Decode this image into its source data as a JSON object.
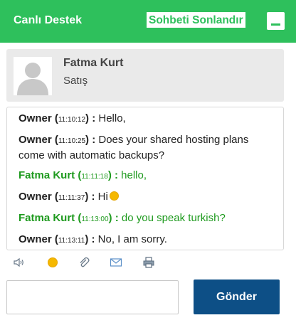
{
  "header": {
    "title": "Canlı Destek",
    "end_chat_label": "Sohbeti Sonlandır",
    "minimize_icon": "minimize-icon",
    "bg_color": "#2ec05c"
  },
  "agent": {
    "name": "Fatma Kurt",
    "department": "Satış",
    "avatar_icon": "user-avatar-icon"
  },
  "messages": [
    {
      "sender": "Owner",
      "time": "11:10:12",
      "text": "Hello,",
      "role": "visitor"
    },
    {
      "sender": "Owner",
      "time": "11:10:25",
      "text": "Does your shared hosting plans come with automatic backups?",
      "role": "visitor"
    },
    {
      "sender": "Fatma Kurt",
      "time": "11:11:18",
      "text": "hello,",
      "role": "agent"
    },
    {
      "sender": "Owner",
      "time": "11:11:37",
      "text": "Hi",
      "role": "visitor",
      "emoji": "smiley-icon"
    },
    {
      "sender": "Fatma Kurt",
      "time": "11:13:00",
      "text": "do you speak turkish?",
      "role": "agent"
    },
    {
      "sender": "Owner",
      "time": "11:13:11",
      "text": "No, I am sorry.",
      "role": "visitor"
    }
  ],
  "toolbar": {
    "icons": [
      "sound-icon",
      "emoji-icon",
      "attachment-icon",
      "email-icon",
      "print-icon"
    ]
  },
  "composer": {
    "value": "",
    "send_label": "Gönder",
    "send_color": "#0d4f86"
  },
  "colors": {
    "agent_text": "#1e9a1e"
  }
}
